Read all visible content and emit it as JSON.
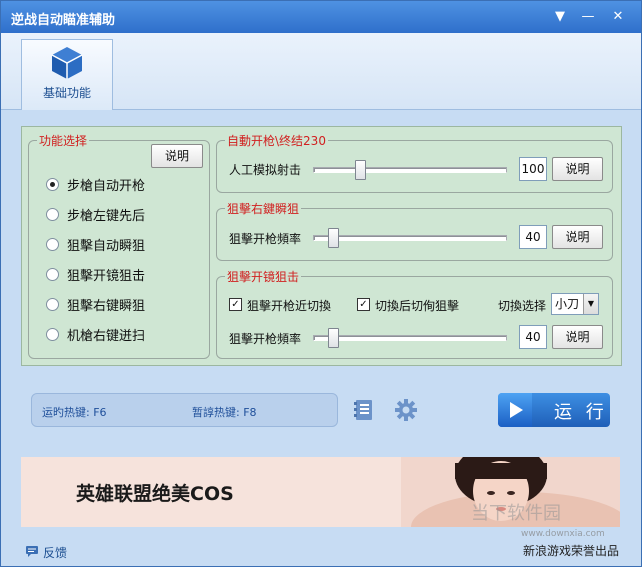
{
  "window": {
    "title": "逆战自动瞄准辅助"
  },
  "titlebar": {
    "menu_glyph": "▼",
    "minimize_glyph": "—",
    "close_glyph": "✕"
  },
  "tab": {
    "label": "基础功能",
    "icon": "cube-icon"
  },
  "function_select": {
    "legend": "功能选择",
    "info_button": "说明",
    "options": [
      "步槍自动开枪",
      "步槍左键先后",
      "狙擊自动瞬狙",
      "狙擊开镜狙击",
      "狙擊右键瞬狙",
      "机槍右键迸扫"
    ],
    "selected_index": 0
  },
  "auto_fire": {
    "legend": "自動开枪\\终结230",
    "label": "人工模拟射击",
    "slider_fraction": 0.23,
    "value": "100",
    "info_button": "说明"
  },
  "sniper_right": {
    "legend": "狙擊右鍵瞬狙",
    "label": "狙擊开枪頻率",
    "slider_fraction": 0.08,
    "value": "40",
    "info_button": "说明"
  },
  "sniper_scope": {
    "legend": "狙擊开镜狙击",
    "check1_label": "狙擊开枪近切換",
    "check1_checked": true,
    "check2_label": "切換后切侚狙擊",
    "check2_checked": true,
    "switch_label": "切換选择",
    "switch_value": "小刀",
    "label": "狙擊开枪頻率",
    "slider_fraction": 0.08,
    "value": "40",
    "info_button": "说明"
  },
  "hotkeys": {
    "run_label": "运旳热键: F6",
    "pause_label": "暂諄热键: F8"
  },
  "toolbar": {
    "notes_icon": "notes-icon",
    "settings_icon": "gear-icon"
  },
  "run_button": {
    "label": "运 行"
  },
  "banner": {
    "text": "英雄联盟绝美COS"
  },
  "watermark": {
    "text": "当下软件园",
    "url": "www.downxia.com"
  },
  "footer": {
    "feedback": "反馈",
    "sponsor": "新浪游戏荣誉出品"
  }
}
